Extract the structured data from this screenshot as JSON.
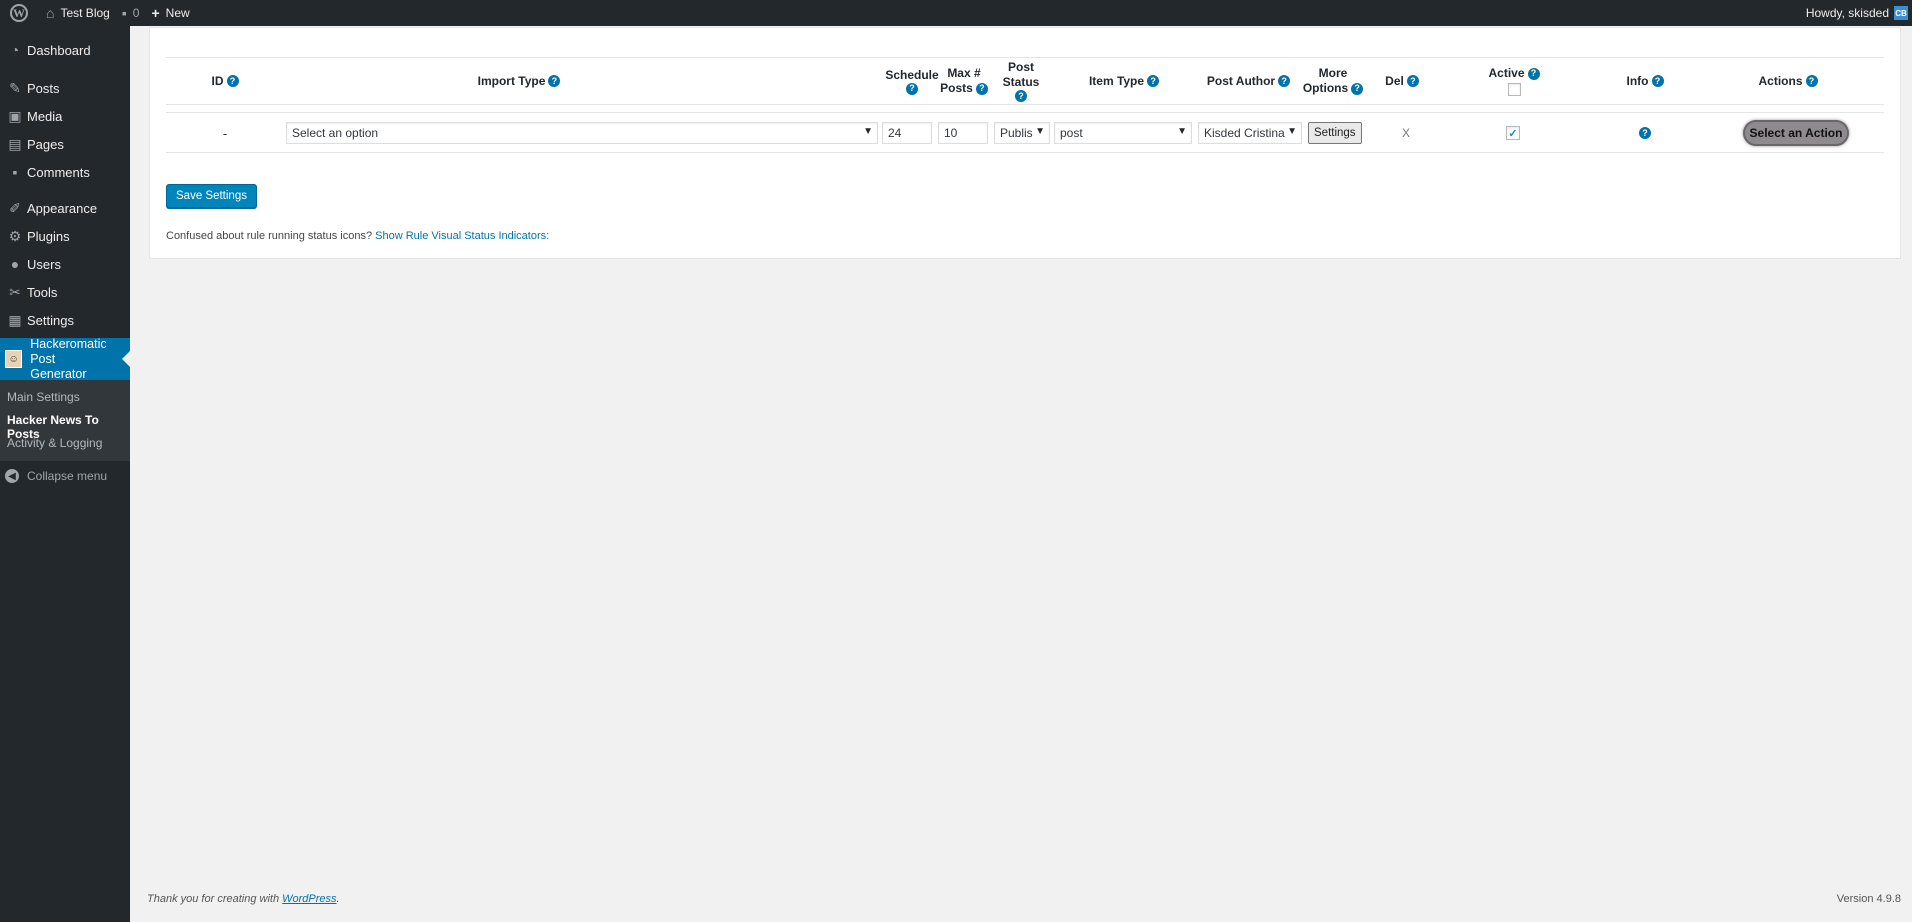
{
  "admin_bar": {
    "site_name": "Test Blog",
    "comments_count": "0",
    "new_label": "New",
    "greeting": "Howdy, skisded",
    "avatar_initials": "CB"
  },
  "sidebar": {
    "items": [
      {
        "label": "Dashboard",
        "icon": "dashboard-icon"
      },
      {
        "label": "Posts",
        "icon": "pin-icon"
      },
      {
        "label": "Media",
        "icon": "media-icon"
      },
      {
        "label": "Pages",
        "icon": "pages-icon"
      },
      {
        "label": "Comments",
        "icon": "comments-icon"
      },
      {
        "label": "Appearance",
        "icon": "brush-icon"
      },
      {
        "label": "Plugins",
        "icon": "plugin-icon"
      },
      {
        "label": "Users",
        "icon": "users-icon"
      },
      {
        "label": "Tools",
        "icon": "wrench-icon"
      },
      {
        "label": "Settings",
        "icon": "settings-icon"
      }
    ],
    "active": {
      "label_line1": "Hackeromatic Post",
      "label_line2": "Generator"
    },
    "submenu": [
      "Main Settings",
      "Hacker News To Posts",
      "Activity & Logging"
    ],
    "collapse_label": "Collapse menu"
  },
  "table": {
    "headers": {
      "id": "ID",
      "import_type": "Import Type",
      "schedule": "Schedule",
      "max_posts_line1": "Max #",
      "max_posts_line2": "Posts",
      "post_status": "Post Status",
      "item_type": "Item Type",
      "post_author": "Post Author",
      "more_options_line1": "More",
      "more_options_line2": "Options",
      "del": "Del",
      "active": "Active",
      "info": "Info",
      "actions": "Actions"
    },
    "row": {
      "id": "-",
      "import_type": "Select an option",
      "schedule": "24",
      "max_posts": "10",
      "post_status": "Publis",
      "item_type": "post",
      "post_author": "Kisded Cristina",
      "more_options_button": "Settings",
      "del": "X",
      "active_checked": true,
      "action_button": "Select an Action"
    }
  },
  "save_button": "Save Settings",
  "confused_text": "Confused about rule running status icons?",
  "confused_link": "Show Rule Visual Status Indicators:",
  "footer": {
    "thank_you_prefix": "Thank you for creating with",
    "wordpress_link": "WordPress",
    "suffix": ".",
    "version": "Version 4.9.8"
  },
  "colors": {
    "admin_dark": "#23282d",
    "accent_blue": "#0073aa",
    "button_blue": "#0085ba",
    "background": "#f1f1f1"
  }
}
